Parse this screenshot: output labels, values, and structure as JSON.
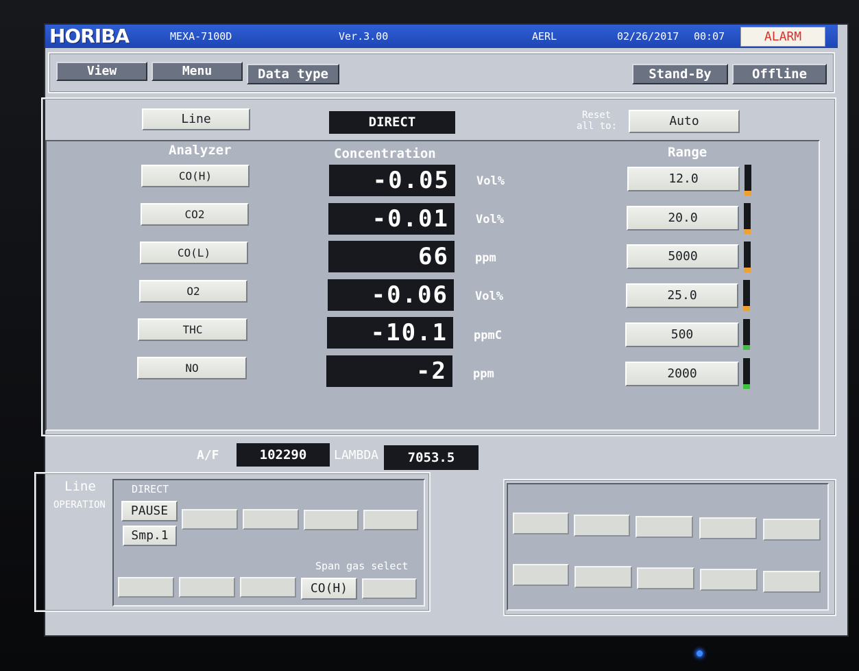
{
  "titlebar": {
    "logo": "HORIBA",
    "model": "MEXA-7100D",
    "version": "Ver.3.00",
    "site": "AERL",
    "date": "02/26/2017",
    "time": "00:07",
    "alarm": "ALARM"
  },
  "toolbar": {
    "view": "View",
    "menu": "Menu",
    "data_type": "Data type",
    "stand_by": "Stand-By",
    "offline": "Offline"
  },
  "top_controls": {
    "line": "Line",
    "mode": "DIRECT",
    "reset_line1": "Reset",
    "reset_line2": "all to:",
    "auto": "Auto"
  },
  "headers": {
    "analyzer": "Analyzer",
    "concentration": "Concentration",
    "range": "Range"
  },
  "rows": [
    {
      "analyzer": "CO(H)",
      "value": "-0.05",
      "unit": "Vol%",
      "range": "12.0",
      "bar_level": 0.15,
      "bar_color": "#f0a030"
    },
    {
      "analyzer": "CO2",
      "value": "-0.01",
      "unit": "Vol%",
      "range": "20.0",
      "bar_level": 0.15,
      "bar_color": "#f0a030"
    },
    {
      "analyzer": "CO(L)",
      "value": "66",
      "unit": "ppm",
      "range": "5000",
      "bar_level": 0.15,
      "bar_color": "#f0a030"
    },
    {
      "analyzer": "O2",
      "value": "-0.06",
      "unit": "Vol%",
      "range": "25.0",
      "bar_level": 0.15,
      "bar_color": "#f0a030"
    },
    {
      "analyzer": "THC",
      "value": "-10.1",
      "unit": "ppmC",
      "range": "500",
      "bar_level": 0.15,
      "bar_color": "#40c040"
    },
    {
      "analyzer": "NO",
      "value": "-2",
      "unit": "ppm",
      "range": "2000",
      "bar_level": 0.15,
      "bar_color": "#40c040"
    }
  ],
  "ratios": {
    "af_label": "A/F",
    "af_value": "102290",
    "lambda_label": "LAMBDA",
    "lambda_value": "7053.5"
  },
  "bottom": {
    "line_label": "Line",
    "operation_label": "OPERATION",
    "direct_label": "DIRECT",
    "pause": "PAUSE",
    "smp": "Smp.1",
    "span_gas_label": "Span gas select",
    "span_gas_value": "CO(H)"
  },
  "colors": {
    "titlebar": "#2f5fd6",
    "alarm_text": "#d6322a",
    "panel_bg": "#aeb4bf"
  }
}
